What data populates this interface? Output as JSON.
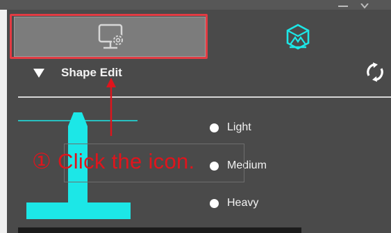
{
  "window": {
    "controls": [
      "minimize",
      "close"
    ]
  },
  "tabs": [
    {
      "name": "settings",
      "icon": "monitor-gear-icon",
      "selected": true
    },
    {
      "name": "shape",
      "icon": "shape-cube-icon",
      "selected": false
    }
  ],
  "section": {
    "title": "Shape Edit",
    "expanded": true,
    "refresh_icon": "refresh-icon"
  },
  "options": [
    {
      "label": "Light",
      "selected": false
    },
    {
      "label": "Medium",
      "selected": false
    },
    {
      "label": "Heavy",
      "selected": false
    }
  ],
  "annotation": {
    "text": "① Click the icon."
  },
  "colors": {
    "accent": "#1ce7e7",
    "highlight": "#e23b43",
    "annotation_text": "#e0141c",
    "panel": "#4a4a4a",
    "tab_selected": "#7c7c7c"
  }
}
